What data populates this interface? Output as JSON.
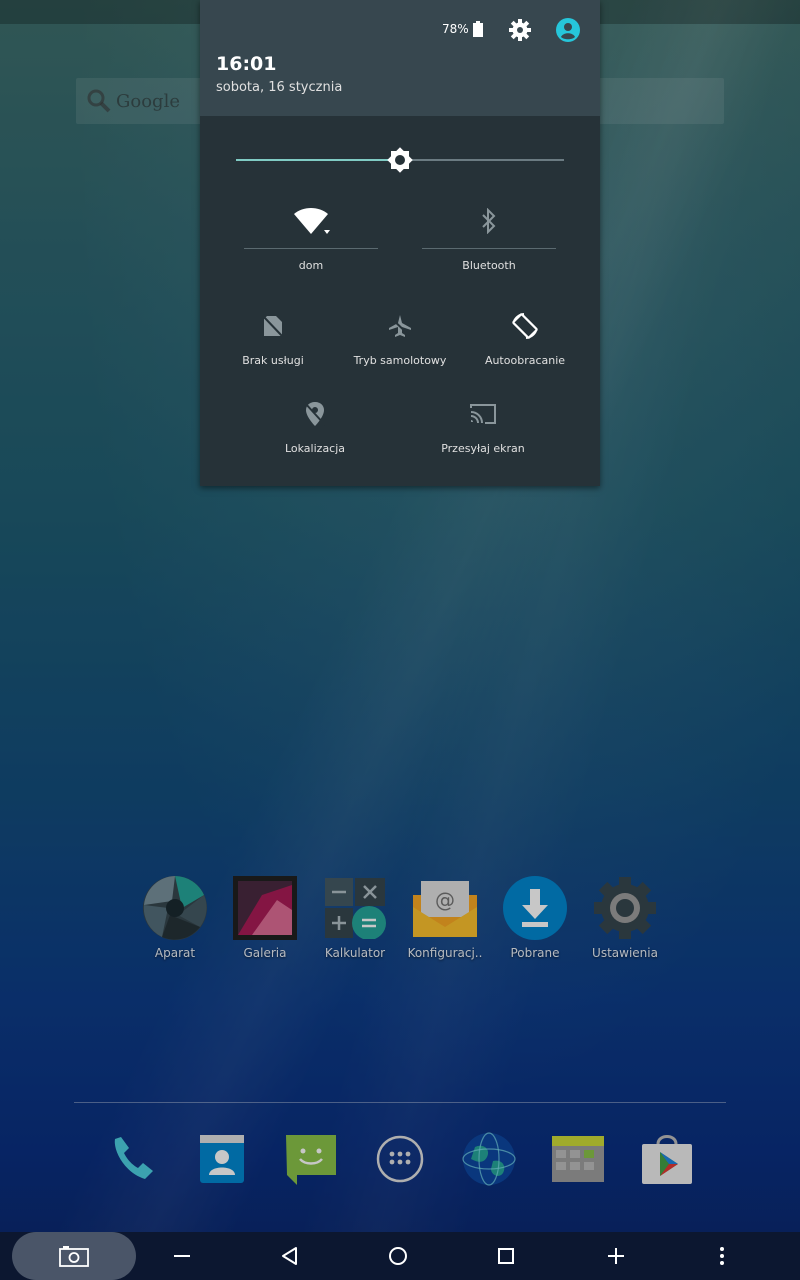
{
  "status": {
    "battery_percent": "78%"
  },
  "shade": {
    "time": "16:01",
    "date": "sobota, 16 stycznia",
    "brightness_level": 0.5,
    "tiles_row1": [
      {
        "id": "wifi",
        "icon": "wifi-icon",
        "label": "dom",
        "active": true
      },
      {
        "id": "bluetooth",
        "icon": "bluetooth-icon",
        "label": "Bluetooth",
        "active": false
      }
    ],
    "tiles_row2": [
      {
        "id": "no-service",
        "icon": "no-sim-icon",
        "label": "Brak usługi",
        "active": false
      },
      {
        "id": "airplane",
        "icon": "airplane-icon",
        "label": "Tryb samolotowy",
        "active": false
      },
      {
        "id": "autorotate",
        "icon": "rotate-icon",
        "label": "Autoobracanie",
        "active": true
      }
    ],
    "tiles_row3": [
      {
        "id": "location",
        "icon": "location-off-icon",
        "label": "Lokalizacja",
        "active": false
      },
      {
        "id": "cast",
        "icon": "cast-icon",
        "label": "Przesyłaj ekran",
        "active": false
      }
    ]
  },
  "widget": {
    "google_text": "Google"
  },
  "apps": [
    {
      "icon": "camera-aperture-icon",
      "label": "Aparat"
    },
    {
      "icon": "gallery-icon",
      "label": "Galeria"
    },
    {
      "icon": "calculator-icon",
      "label": "Kalkulator"
    },
    {
      "icon": "email-icon",
      "label": "Konfiguracj.."
    },
    {
      "icon": "download-icon",
      "label": "Pobrane"
    },
    {
      "icon": "settings-gear-icon",
      "label": "Ustawienia"
    }
  ],
  "dock": [
    "phone-icon",
    "contacts-icon",
    "messaging-icon",
    "app-drawer-icon",
    "browser-globe-icon",
    "gallery-grid-icon",
    "play-store-icon"
  ],
  "colors": {
    "accent": "#80cbc4",
    "shade_bg": "#263238",
    "header_bg": "#37474f",
    "user_icon": "#26c6da"
  }
}
